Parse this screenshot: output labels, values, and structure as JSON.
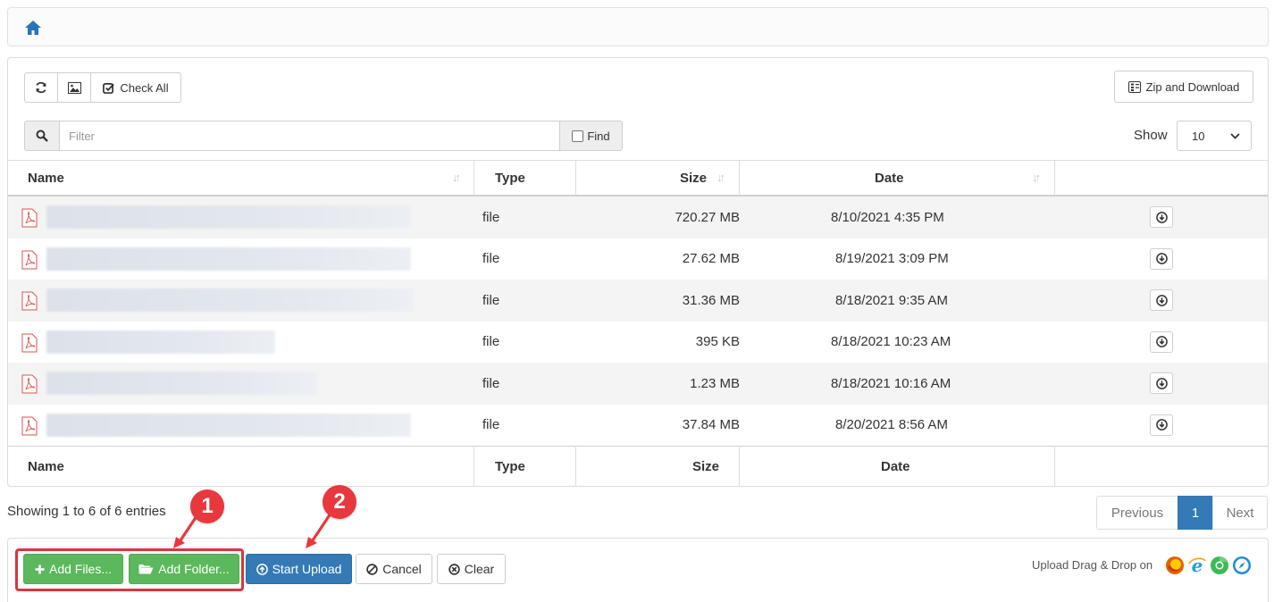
{
  "toolbar": {
    "check_all": "Check All",
    "zip_download": "Zip and Download",
    "filter_placeholder": "Filter",
    "find": "Find",
    "show_label": "Show",
    "show_value": "10"
  },
  "table": {
    "columns": [
      "Name",
      "Type",
      "Size",
      "Date"
    ],
    "rows": [
      {
        "type": "file",
        "size": "720.27 MB",
        "date": "8/10/2021 4:35 PM"
      },
      {
        "type": "file",
        "size": "27.62 MB",
        "date": "8/19/2021 3:09 PM"
      },
      {
        "type": "file",
        "size": "31.36 MB",
        "date": "8/18/2021 9:35 AM"
      },
      {
        "type": "file",
        "size": "395 KB",
        "date": "8/18/2021 10:23 AM"
      },
      {
        "type": "file",
        "size": "1.23 MB",
        "date": "8/18/2021 10:16 AM"
      },
      {
        "type": "file",
        "size": "37.84 MB",
        "date": "8/20/2021 8:56 AM"
      }
    ]
  },
  "pagination": {
    "info": "Showing 1 to 6 of 6 entries",
    "previous": "Previous",
    "current": "1",
    "next": "Next"
  },
  "upload": {
    "add_files": "Add Files...",
    "add_folder": "Add Folder...",
    "start_upload": "Start Upload",
    "cancel": "Cancel",
    "clear": "Clear",
    "drag_drop": "Upload Drag & Drop on"
  },
  "annotations": {
    "badge_1": "1",
    "badge_2": "2"
  },
  "colors": {
    "primary": "#337ab7",
    "success": "#5cb85c",
    "annotation_red": "#e8383d",
    "pdf_red": "#d9534f"
  }
}
